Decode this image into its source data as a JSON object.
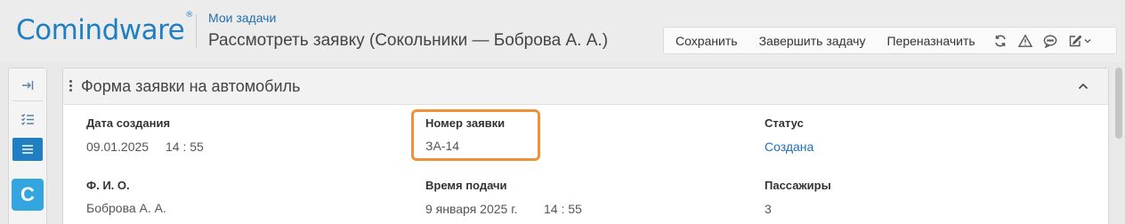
{
  "header": {
    "logo": "Comindware",
    "logo_mark": "®",
    "breadcrumb": "Мои задачи",
    "title": "Рассмотреть заявку (Сокольники — Боброва А. А.)"
  },
  "toolbar": {
    "save": "Сохранить",
    "complete": "Завершить задачу",
    "reassign": "Переназначить",
    "icons": [
      "refresh-icon",
      "warning-icon",
      "comment-icon",
      "edit-icon",
      "chevron-down-icon"
    ]
  },
  "sidebar": {
    "icons": [
      "collapse-sidebar-icon",
      "checklist-icon",
      "form-list-icon"
    ],
    "app_letter": "C",
    "app_color": "#33a6e0",
    "accent": "#1f7fc2"
  },
  "form": {
    "title": "Форма заявки на автомобиль",
    "fields": {
      "created_label": "Дата создания",
      "created_date": "09.01.2025",
      "created_time": "14 : 55",
      "number_label": "Номер заявки",
      "number_value": "ЗА-14",
      "status_label": "Статус",
      "status_value": "Создана",
      "fio_label": "Ф. И. О.",
      "fio_value": "Боброва А. А.",
      "time_label": "Время подачи",
      "time_date": "9 января 2025 г.",
      "time_time": "14 : 55",
      "passengers_label": "Пассажиры",
      "passengers_value": "3"
    },
    "highlight_color": "#f0913a"
  }
}
